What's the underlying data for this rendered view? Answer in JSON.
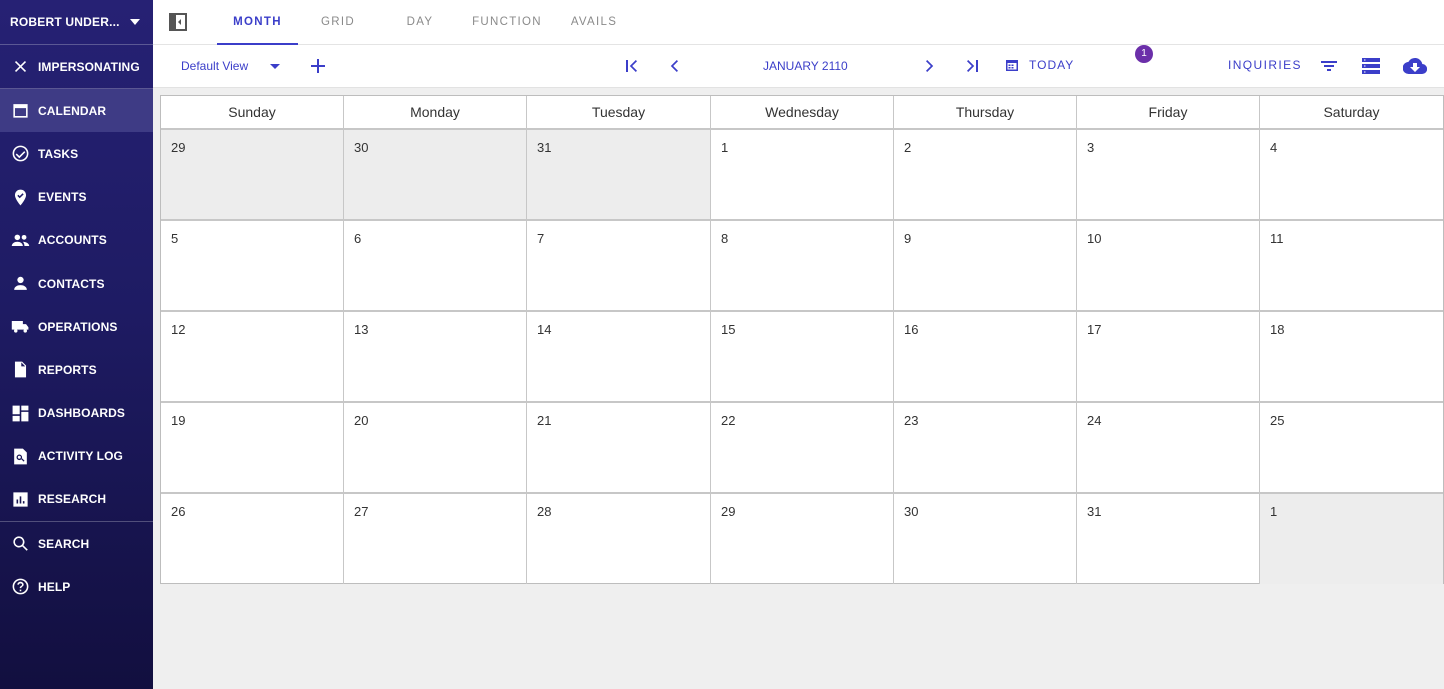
{
  "sidebar": {
    "user_name": "ROBERT UNDER...",
    "items": [
      {
        "label": "IMPERSONATING",
        "icon": "close-icon"
      },
      {
        "label": "CALENDAR",
        "icon": "calendar-icon"
      },
      {
        "label": "TASKS",
        "icon": "check-circle-icon"
      },
      {
        "label": "EVENTS",
        "icon": "location-pin-icon"
      },
      {
        "label": "ACCOUNTS",
        "icon": "people-icon"
      },
      {
        "label": "CONTACTS",
        "icon": "person-icon"
      },
      {
        "label": "OPERATIONS",
        "icon": "truck-icon"
      },
      {
        "label": "REPORTS",
        "icon": "document-icon"
      },
      {
        "label": "DASHBOARDS",
        "icon": "dashboard-icon"
      },
      {
        "label": "ACTIVITY LOG",
        "icon": "activity-log-icon"
      },
      {
        "label": "RESEARCH",
        "icon": "bar-chart-icon"
      },
      {
        "label": "SEARCH",
        "icon": "search-icon"
      },
      {
        "label": "HELP",
        "icon": "help-icon"
      }
    ]
  },
  "tabs": [
    "MONTH",
    "GRID",
    "DAY",
    "FUNCTION",
    "AVAILS"
  ],
  "toolbar": {
    "view_label": "Default View",
    "month_label": "JANUARY 2110",
    "today_label": "TODAY",
    "inquiries_label": "INQUIRIES",
    "inquiries_count": "1"
  },
  "calendar": {
    "weekdays": [
      "Sunday",
      "Monday",
      "Tuesday",
      "Wednesday",
      "Thursday",
      "Friday",
      "Saturday"
    ],
    "weeks": [
      [
        "29",
        "30",
        "31",
        "1",
        "2",
        "3",
        "4"
      ],
      [
        "5",
        "6",
        "7",
        "8",
        "9",
        "10",
        "11"
      ],
      [
        "12",
        "13",
        "14",
        "15",
        "16",
        "17",
        "18"
      ],
      [
        "19",
        "20",
        "21",
        "22",
        "23",
        "24",
        "25"
      ],
      [
        "26",
        "27",
        "28",
        "29",
        "30",
        "31",
        "1"
      ]
    ]
  },
  "colors": {
    "accent": "#3b3ec9",
    "sidebar": "#262174",
    "badge": "#6b2fa9"
  }
}
